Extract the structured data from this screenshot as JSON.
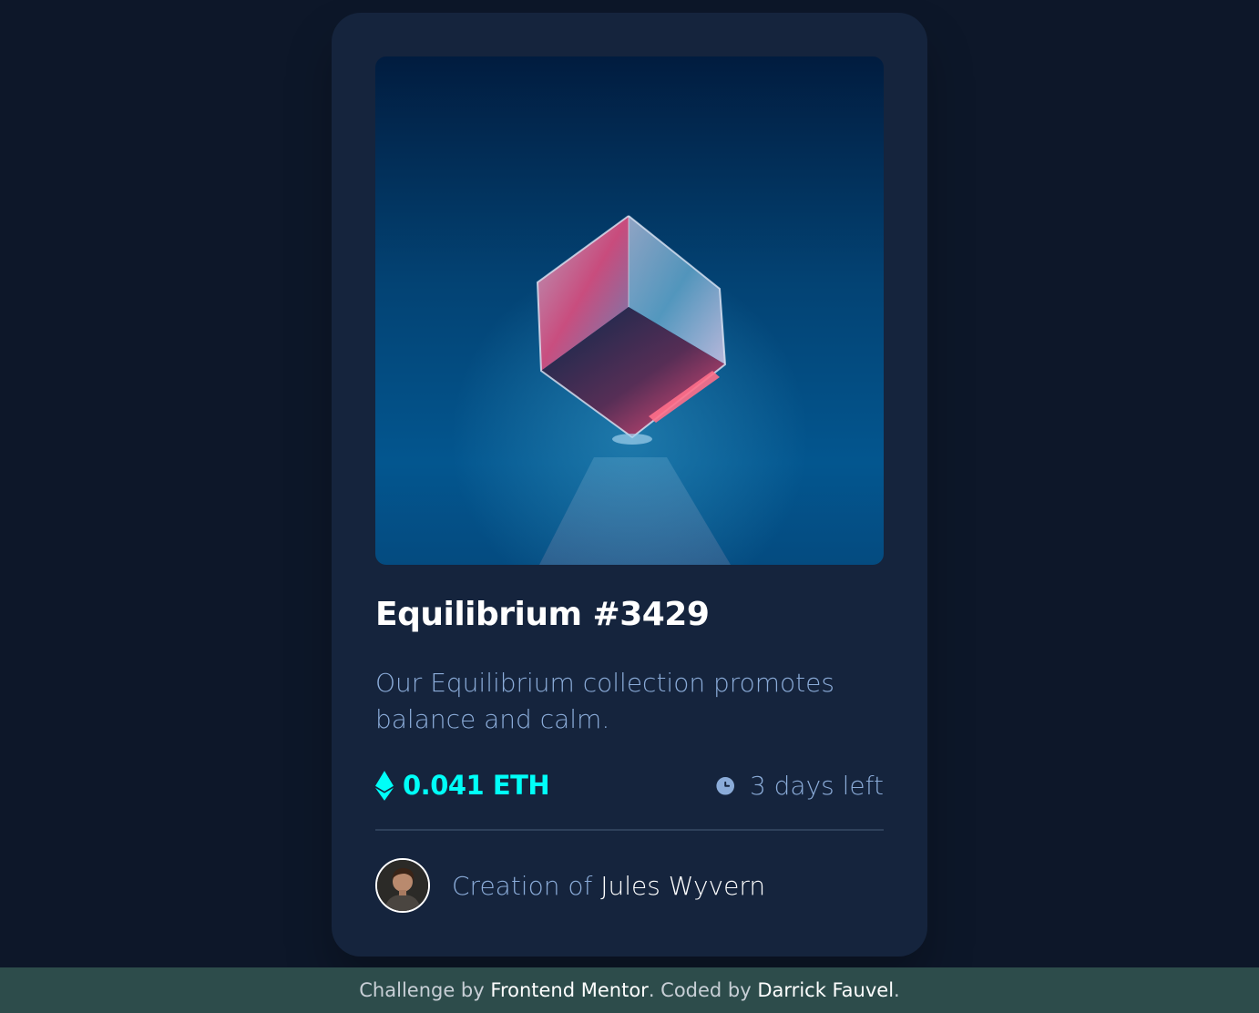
{
  "card": {
    "image_alt": "Equilibrium",
    "title": "Equilibrium #3429",
    "description": "Our Equilibrium collection promotes balance and calm.",
    "price": "0.041 ETH",
    "time_left": "3 days left",
    "creation_prefix": "Creation of",
    "creator_name": "Jules Wyvern"
  },
  "footer": {
    "text1": "Challenge by",
    "link1": "Frontend Mentor",
    "text2": ". Coded by",
    "link2": "Darrick Fauvel",
    "text3": "."
  },
  "colors": {
    "page_bg": "#0d1729",
    "card_bg": "#15243d",
    "accent_cyan": "#00fff8",
    "soft_blue": "#8bacd9",
    "divider": "#2e405a",
    "footer_bg": "#2d4c4b",
    "white": "#ffffff"
  },
  "icons": {
    "price": "ethereum-icon",
    "time": "clock-icon"
  }
}
